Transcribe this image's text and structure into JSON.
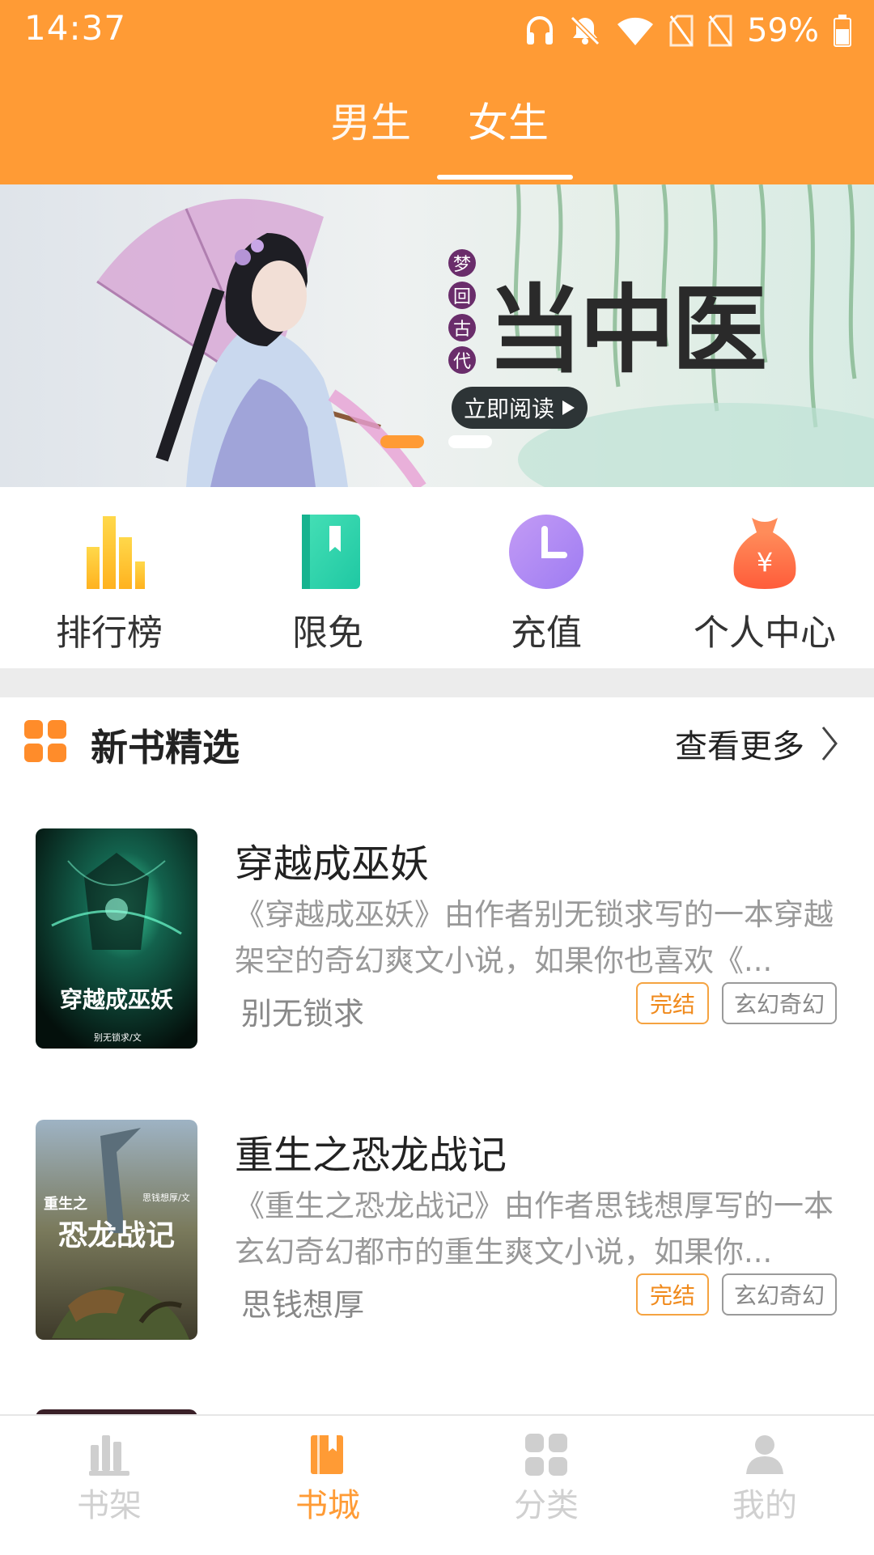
{
  "status_bar": {
    "time": "14:37",
    "battery": "59%",
    "icons": [
      "headphones-icon",
      "bell-muted-icon",
      "wifi-icon",
      "no-sim-icon",
      "no-sim-icon",
      "battery-icon"
    ]
  },
  "header": {
    "tabs": [
      {
        "label": "男生",
        "active": false
      },
      {
        "label": "女生",
        "active": true
      }
    ]
  },
  "banner": {
    "vertical_text": [
      "梦",
      "回",
      "古",
      "代"
    ],
    "title": "当中医",
    "button_label": "立即阅读",
    "button_icon": "play-triangle-icon",
    "slide_count": 2,
    "active_slide": 1
  },
  "quick_menu": [
    {
      "label": "排行榜",
      "icon": "ranking-bars-icon"
    },
    {
      "label": "限免",
      "icon": "book-bookmark-icon"
    },
    {
      "label": "充值",
      "icon": "clock-icon"
    },
    {
      "label": "个人中心",
      "icon": "money-bag-icon"
    }
  ],
  "section": {
    "title": "新书精选",
    "more_label": "查看更多",
    "more_icon": "chevron-right-icon"
  },
  "books": [
    {
      "title": "穿越成巫妖",
      "description": "《穿越成巫妖》由作者别无锁求写的一本穿越架空的奇幻爽文小说，如果你也喜欢《...",
      "author": "别无锁求",
      "status": "完结",
      "genre": "玄幻奇幻",
      "cover_title": "穿越成巫妖",
      "cover_author": "别无锁求/文"
    },
    {
      "title": "重生之恐龙战记",
      "description": "《重生之恐龙战记》由作者思钱想厚写的一本玄幻奇幻都市的重生爽文小说，如果你...",
      "author": "思钱想厚",
      "status": "完结",
      "genre": "玄幻奇幻",
      "cover_title_top": "重生之",
      "cover_title": "恐龙战记",
      "cover_author": "思钱想厚/文"
    }
  ],
  "bottom_nav": [
    {
      "label": "书架",
      "icon": "bookshelf-icon",
      "active": false
    },
    {
      "label": "书城",
      "icon": "bookstore-icon",
      "active": true
    },
    {
      "label": "分类",
      "icon": "category-grid-icon",
      "active": false
    },
    {
      "label": "我的",
      "icon": "user-icon",
      "active": false
    }
  ],
  "colors": {
    "accent": "#FF9B35",
    "tag_status": "#F08A1C",
    "text_muted": "#999999",
    "nav_inactive": "#d0d0d0"
  }
}
